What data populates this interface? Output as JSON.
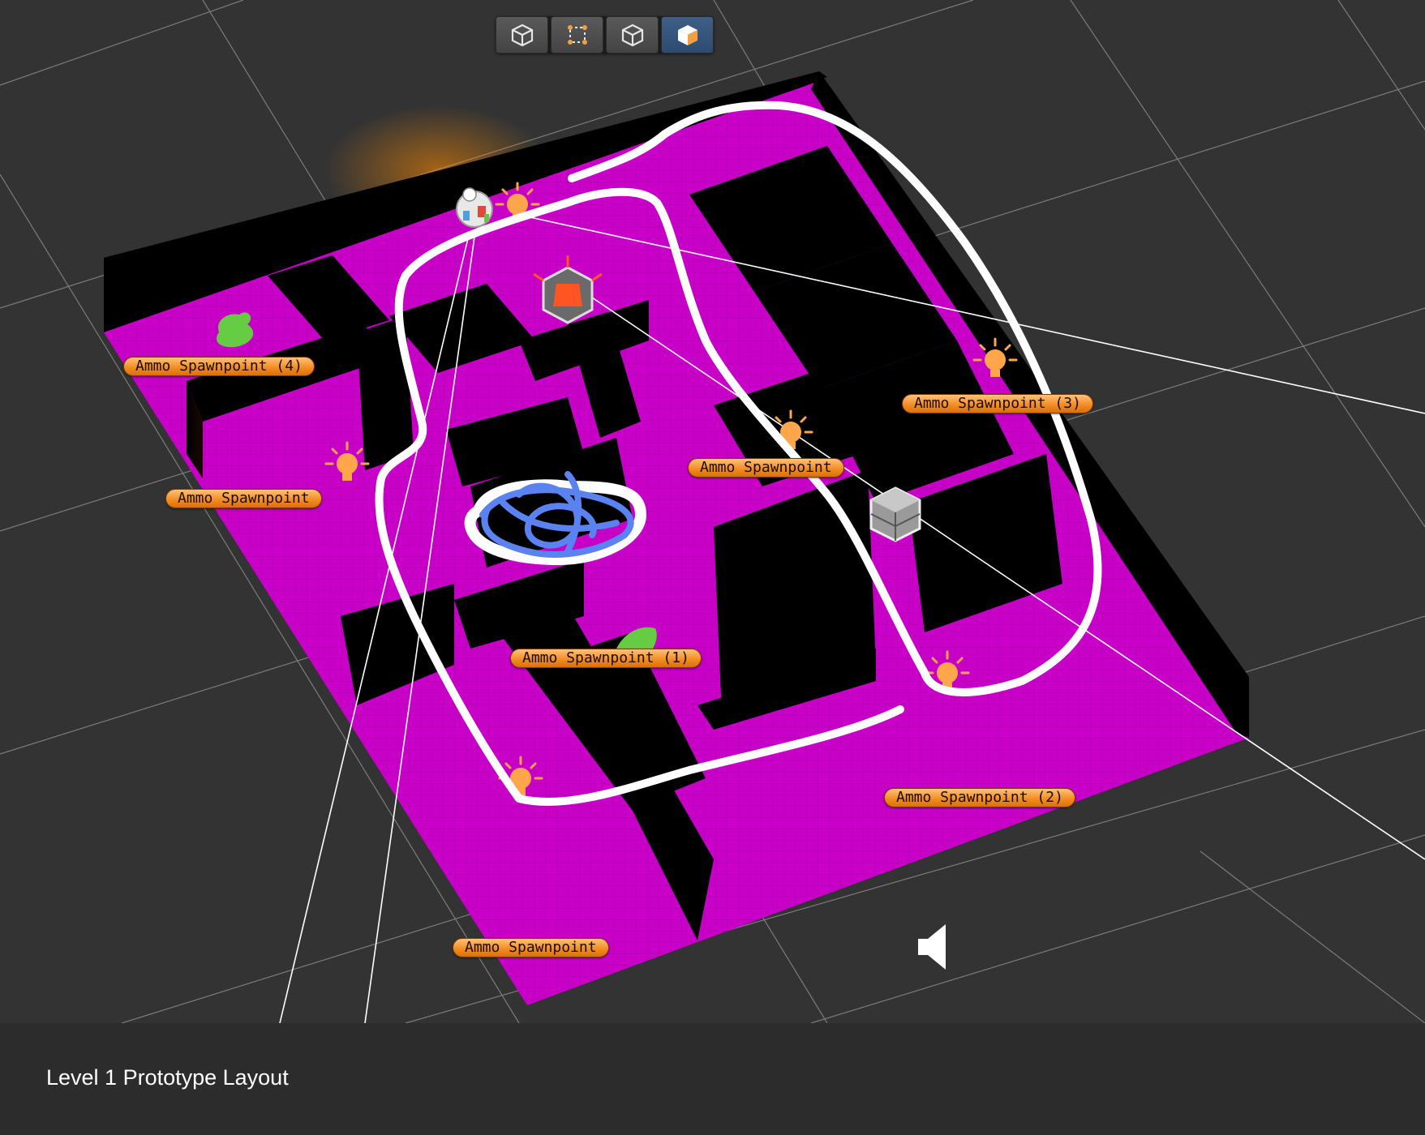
{
  "caption": "Level 1 Prototype Layout",
  "toolbar": {
    "buttons": [
      {
        "icon": "cube-outline-icon",
        "active": false
      },
      {
        "icon": "rect-transform-icon",
        "active": false
      },
      {
        "icon": "cube-solid-icon",
        "active": false
      },
      {
        "icon": "cube-shaded-icon",
        "active": true
      }
    ]
  },
  "spawn_labels": [
    "Ammo Spawnpoint (4)",
    "Ammo Spawnpoint (3)",
    "Ammo Spawnpoint",
    "Ammo Spawnpoint",
    "Ammo Spawnpoint (1)",
    "Ammo Spawnpoint (2)",
    "Ammo Spawnpoint"
  ],
  "colors": {
    "floor": "#c800c8",
    "wall": "#000000",
    "grid_bg": "#333333",
    "label_orange": "#f28a1e",
    "annotation_white": "#ffffff",
    "annotation_blue": "#5a82f0",
    "annotation_green": "#66cc44",
    "light_icon": "#ffa64d"
  },
  "icons": [
    "light-bulb-icon",
    "camera-gizmo-icon",
    "crate-icon",
    "speaker-icon",
    "character-icon"
  ]
}
